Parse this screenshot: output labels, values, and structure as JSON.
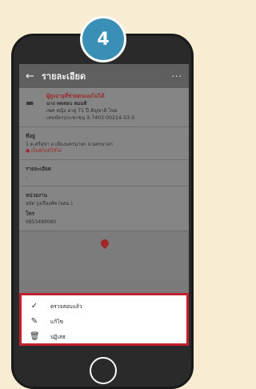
{
  "step_badge": "4",
  "appbar": {
    "title": "รายละเอียด",
    "more": "···"
  },
  "patient": {
    "status": "ผู้สูงอายุที่ช่วยตนเองไม่ได้",
    "name": "นาง ทดสอบ สมมติ",
    "details": "เพศ หญิง อายุ 71 ปี สัญชาติ ไทย",
    "id_label": "เลขบัตรประชาชน 3-7403-00214-53-5"
  },
  "address": {
    "label": "ที่อยู่",
    "text": "1 ต.ศรีสุข่า อ.เมืองนครนายก จ.นครนายก",
    "warning": "● เป็นพิกัดที่ใช้ได้"
  },
  "detail": {
    "label": "รายละเอียด",
    "text": "-"
  },
  "agency": {
    "label": "หน่วยงาน",
    "text": "อบัต รูงเรืองทัพ (อสม.)",
    "phone_label": "โทร",
    "phone": "0853489080"
  },
  "sheet": {
    "items": [
      {
        "icon": "check-icon",
        "label": "ตรวจสอบแล้ว"
      },
      {
        "icon": "pencil-icon",
        "label": "แก้ไข"
      },
      {
        "icon": "trash-icon",
        "label": "ปฏิเสธ"
      }
    ]
  },
  "colors": {
    "background": "#f8ecd2",
    "badge": "#3a8fb6",
    "highlight_border": "#c3202f",
    "status_red": "#9d2b2b"
  }
}
